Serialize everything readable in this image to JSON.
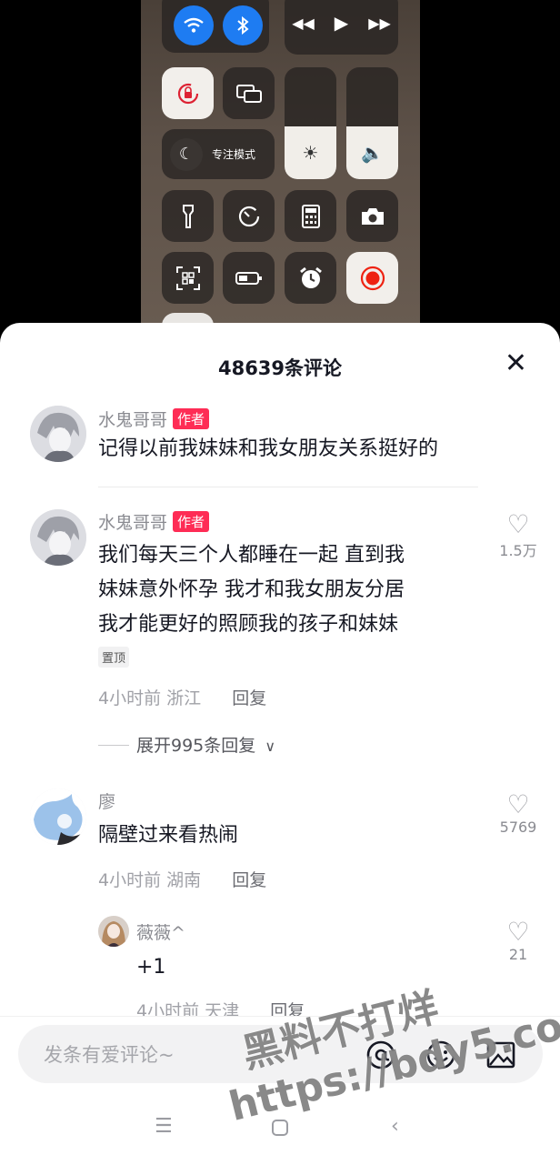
{
  "control_center": {
    "focus_label": "专注模式",
    "icons": [
      "wifi-icon",
      "bluetooth-icon",
      "rewind-icon",
      "play-icon",
      "fast-forward-icon",
      "rotation-lock-icon",
      "screen-mirror-icon",
      "brightness-icon",
      "volume-icon",
      "moon-icon",
      "flashlight-icon",
      "timer-icon",
      "calculator-icon",
      "camera-icon",
      "qr-scan-icon",
      "battery-icon",
      "alarm-icon",
      "record-icon"
    ]
  },
  "sheet": {
    "title": "48639条评论",
    "close_symbol": "✕"
  },
  "comments": [
    {
      "user": "水鬼哥哥",
      "tag": "作者",
      "text": "记得以前我妹妹和我女朋友关系挺好的"
    },
    {
      "user": "水鬼哥哥",
      "tag": "作者",
      "lines": [
        "我们每天三个人都睡在一起 直到我",
        "妹妹意外怀孕 我才和我女朋友分居",
        "我才能更好的照顾我的孩子和妹妹"
      ],
      "pinned": "置顶",
      "time": "4小时前",
      "location": "浙江",
      "reply": "回复",
      "likes": "1.5万",
      "expand": "展开995条回复"
    },
    {
      "user": "廖",
      "text": "隔壁过来看热闹",
      "time": "4小时前",
      "location": "湖南",
      "reply": "回复",
      "likes": "5769"
    },
    {
      "user": "薇薇^",
      "text": "+1",
      "time": "4小时前",
      "location": "天津",
      "reply": "回复",
      "likes": "21"
    }
  ],
  "input": {
    "placeholder": "发条有爱评论~",
    "icons": [
      "at-icon",
      "emoji-icon",
      "image-icon"
    ]
  },
  "watermark": {
    "line1": "黑料不打烊",
    "line2": "https://bdy5.co"
  }
}
